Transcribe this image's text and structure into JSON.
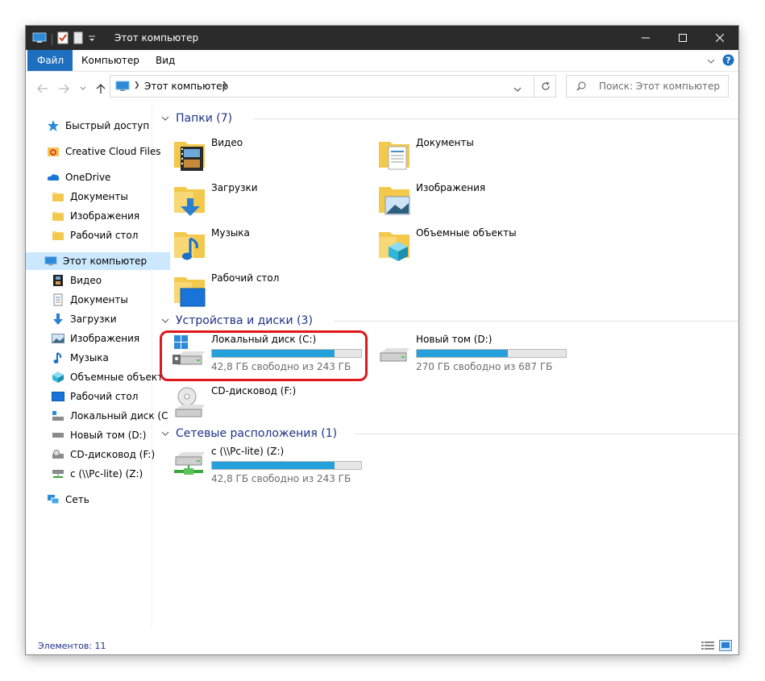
{
  "window": {
    "title": "Этот компьютер"
  },
  "ribbon": {
    "tabs": [
      "Файл",
      "Компьютер",
      "Вид"
    ]
  },
  "address": {
    "path": "Этот компьютер",
    "search_placeholder": "Поиск: Этот компьютер"
  },
  "sidebar": {
    "items": [
      {
        "label": "Быстрый доступ",
        "icon": "star-icon"
      },
      {
        "label": "Creative Cloud Files",
        "icon": "creative-cloud-icon"
      },
      {
        "label": "OneDrive",
        "icon": "cloud-icon"
      },
      {
        "label": "Документы",
        "icon": "folder-icon"
      },
      {
        "label": "Изображения",
        "icon": "folder-icon"
      },
      {
        "label": "Рабочий стол",
        "icon": "folder-icon"
      },
      {
        "label": "Этот компьютер",
        "icon": "computer-icon"
      },
      {
        "label": "Видео",
        "icon": "film-icon"
      },
      {
        "label": "Документы",
        "icon": "document-icon"
      },
      {
        "label": "Загрузки",
        "icon": "download-arrow-icon"
      },
      {
        "label": "Изображения",
        "icon": "picture-icon"
      },
      {
        "label": "Музыка",
        "icon": "music-note-icon"
      },
      {
        "label": "Объемные объект",
        "icon": "cube-icon"
      },
      {
        "label": "Рабочий стол",
        "icon": "desktop-icon"
      },
      {
        "label": "Локальный диск (С",
        "icon": "system-drive-icon"
      },
      {
        "label": "Новый том (D:)",
        "icon": "drive-icon"
      },
      {
        "label": "CD-дисковод (F:)",
        "icon": "cd-drive-icon"
      },
      {
        "label": "c (\\\\Pc-lite) (Z:)",
        "icon": "network-drive-icon"
      },
      {
        "label": "Сеть",
        "icon": "network-icon"
      }
    ]
  },
  "sections": {
    "folders": {
      "title": "Папки (7)",
      "items": [
        {
          "label": "Видео",
          "icon": "video-folder-icon"
        },
        {
          "label": "Документы",
          "icon": "documents-folder-icon"
        },
        {
          "label": "Загрузки",
          "icon": "downloads-folder-icon"
        },
        {
          "label": "Изображения",
          "icon": "pictures-folder-icon"
        },
        {
          "label": "Музыка",
          "icon": "music-folder-icon"
        },
        {
          "label": "Объемные объекты",
          "icon": "3d-objects-folder-icon"
        },
        {
          "label": "Рабочий стол",
          "icon": "desktop-folder-icon"
        }
      ]
    },
    "devices": {
      "title": "Устройства и диски (3)",
      "items": [
        {
          "label": "Локальный диск (C:)",
          "free": "42,8 ГБ свободно из 243 ГБ",
          "used_fraction": 0.82,
          "icon": "system-drive-icon",
          "highlighted": true
        },
        {
          "label": "Новый том (D:)",
          "free": "270 ГБ свободно из 687 ГБ",
          "used_fraction": 0.61,
          "icon": "drive-icon"
        },
        {
          "label": "CD-дисковод (F:)",
          "icon": "cd-drive-icon"
        }
      ]
    },
    "network": {
      "title": "Сетевые расположения (1)",
      "items": [
        {
          "label": "c (\\\\Pc-lite) (Z:)",
          "free": "42,8 ГБ свободно из 243 ГБ",
          "used_fraction": 0.82,
          "icon": "network-drive-icon"
        }
      ]
    }
  },
  "status": {
    "items_count": "Элементов: 11"
  },
  "colors": {
    "accent": "#1e6fc0",
    "bar_fill": "#26a0da",
    "highlight": "#e0161b",
    "selected": "#cce8ff",
    "section_title": "#1e3287"
  }
}
